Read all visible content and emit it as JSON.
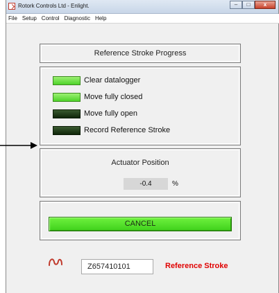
{
  "window": {
    "title": "Rotork Controls Ltd - Enlight.",
    "minimize_label": "–",
    "maximize_label": "□",
    "close_label": "x"
  },
  "menu": {
    "items": [
      "File",
      "Setup",
      "Control",
      "Diagnostic",
      "Help"
    ]
  },
  "progress": {
    "title": "Reference Stroke Progress",
    "steps": [
      {
        "label": "Clear datalogger",
        "state": "on"
      },
      {
        "label": "Move fully closed",
        "state": "on"
      },
      {
        "label": "Move fully open",
        "state": "off"
      },
      {
        "label": "Record Reference Stroke",
        "state": "off"
      }
    ]
  },
  "position": {
    "title": "Actuator Position",
    "value": "-0.4",
    "unit": "%"
  },
  "cancel": {
    "label": "CANCEL"
  },
  "footer": {
    "serial": "Z657410101",
    "status": "Reference Stroke"
  },
  "colors": {
    "led_on": "#4ed32a",
    "led_off": "#0f2609",
    "cancel_green": "#3fd11b",
    "status_red": "#e00000",
    "logo_red": "#c0392b"
  }
}
